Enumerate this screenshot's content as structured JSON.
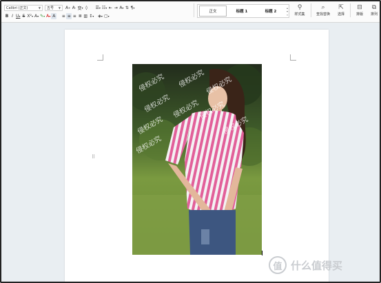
{
  "ribbon": {
    "font_name": "Calibri (正文)",
    "font_size": "五号",
    "row1_icons": [
      "A⁺",
      "A⁻",
      "变",
      "A"
    ],
    "row2_format": [
      "B",
      "I",
      "U",
      "S",
      "X²",
      "X₂",
      "A",
      "A",
      "A",
      "A"
    ],
    "styles": {
      "normal": "正文",
      "heading1": "标题 1",
      "heading2": "标题 2"
    },
    "style_set": {
      "label": "样式集"
    },
    "find_replace": {
      "label": "查找替换"
    },
    "select": {
      "label": "选择"
    },
    "sort": {
      "label": "排版"
    },
    "layout": {
      "label": "排列"
    }
  },
  "document": {
    "image_watermark_text": "侵权必究"
  },
  "brand": {
    "name": "什么值得买",
    "logo_glyph": "值"
  }
}
